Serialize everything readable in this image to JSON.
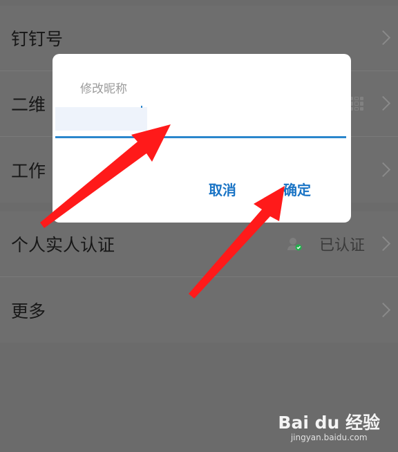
{
  "settings": {
    "group1": [
      {
        "label": "钉钉号"
      },
      {
        "label": "二维"
      },
      {
        "label": "工作"
      }
    ],
    "group2": [
      {
        "label": "个人实人认证",
        "status": "已认证"
      },
      {
        "label": "更多"
      }
    ]
  },
  "dialog": {
    "title": "修改昵称",
    "input_value": "",
    "cancel_label": "取消",
    "confirm_label": "确定"
  },
  "watermark": {
    "logo": "Bai du 经验",
    "url": "jingyan.baidu.com"
  },
  "colors": {
    "accent": "#1a74c5",
    "arrow": "#ff1a1a",
    "verified": "#22b14c"
  }
}
